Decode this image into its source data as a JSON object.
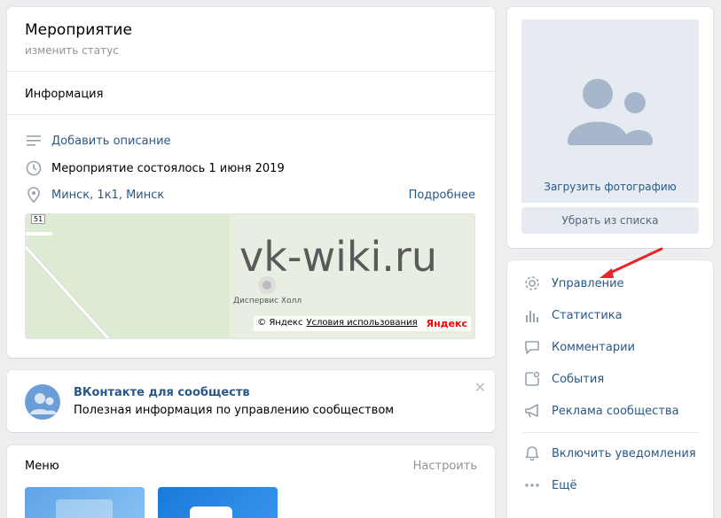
{
  "event": {
    "title": "Мероприятие",
    "status_link": "изменить статус",
    "info_heading": "Информация",
    "add_description": "Добавить описание",
    "date_text": "Мероприятие состоялось 1 июня 2019",
    "location": "Минск, 1к1, Минск",
    "more_link": "Подробнее"
  },
  "map": {
    "place_label": "Диспервис Холл",
    "copyright": "© Яндекс",
    "terms": "Условия использования",
    "brand": "Яндекс",
    "badge": "51"
  },
  "watermark": "vk-wiki.ru",
  "community_tip": {
    "title": "ВКонтакте для сообществ",
    "description": "Полезная информация по управлению сообществом",
    "close": "✕"
  },
  "menu": {
    "title": "Меню",
    "configure": "Настроить"
  },
  "photo": {
    "upload_label": "Загрузить фотографию",
    "remove_button": "Убрать из списка"
  },
  "actions": [
    {
      "label": "Управление",
      "icon": "gear-icon"
    },
    {
      "label": "Статистика",
      "icon": "bar-chart-icon"
    },
    {
      "label": "Комментарии",
      "icon": "comment-icon"
    },
    {
      "label": "События",
      "icon": "event-icon"
    },
    {
      "label": "Реклама сообщества",
      "icon": "megaphone-icon"
    },
    {
      "label": "Включить уведомления",
      "icon": "bell-icon"
    },
    {
      "label": "Ещё",
      "icon": "more-icon"
    }
  ],
  "colors": {
    "link": "#2a5885",
    "accent_arrow": "#e5262a",
    "background": "#edeef0"
  }
}
